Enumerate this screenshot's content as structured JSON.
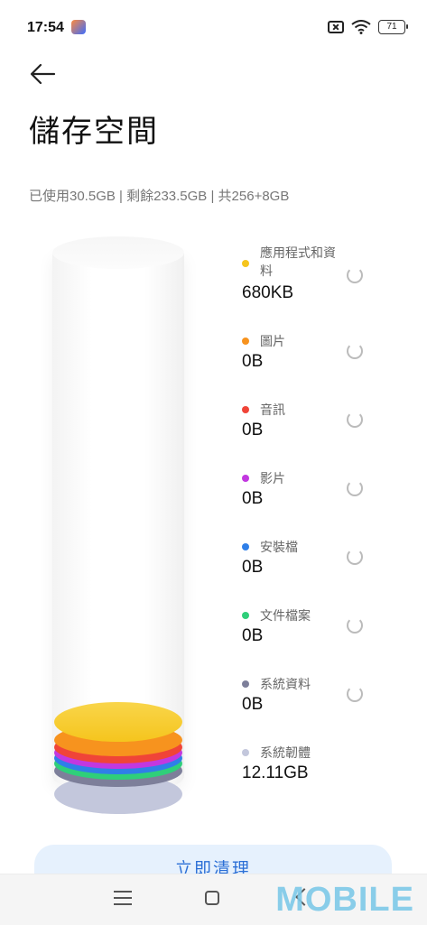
{
  "status_bar": {
    "time": "17:54",
    "battery": "71"
  },
  "header": {
    "title": "儲存空間"
  },
  "summary": {
    "text": "已使用30.5GB | 剩餘233.5GB | 共256+8GB"
  },
  "categories": [
    {
      "label": "應用程式和資料",
      "value": "680KB",
      "color": "#f5c51e"
    },
    {
      "label": "圖片",
      "value": "0B",
      "color": "#f7931e"
    },
    {
      "label": "音訊",
      "value": "0B",
      "color": "#f04438"
    },
    {
      "label": "影片",
      "value": "0B",
      "color": "#c238e0"
    },
    {
      "label": "安裝檔",
      "value": "0B",
      "color": "#2f7fe8"
    },
    {
      "label": "文件檔案",
      "value": "0B",
      "color": "#2fcf7a"
    },
    {
      "label": "系統資料",
      "value": "0B",
      "color": "#7d7f9a"
    },
    {
      "label": "系統韌體",
      "value": "12.11GB",
      "color": "#c3c7dc"
    }
  ],
  "action": {
    "clean_label": "立即清理"
  },
  "watermark": "MOBILE"
}
